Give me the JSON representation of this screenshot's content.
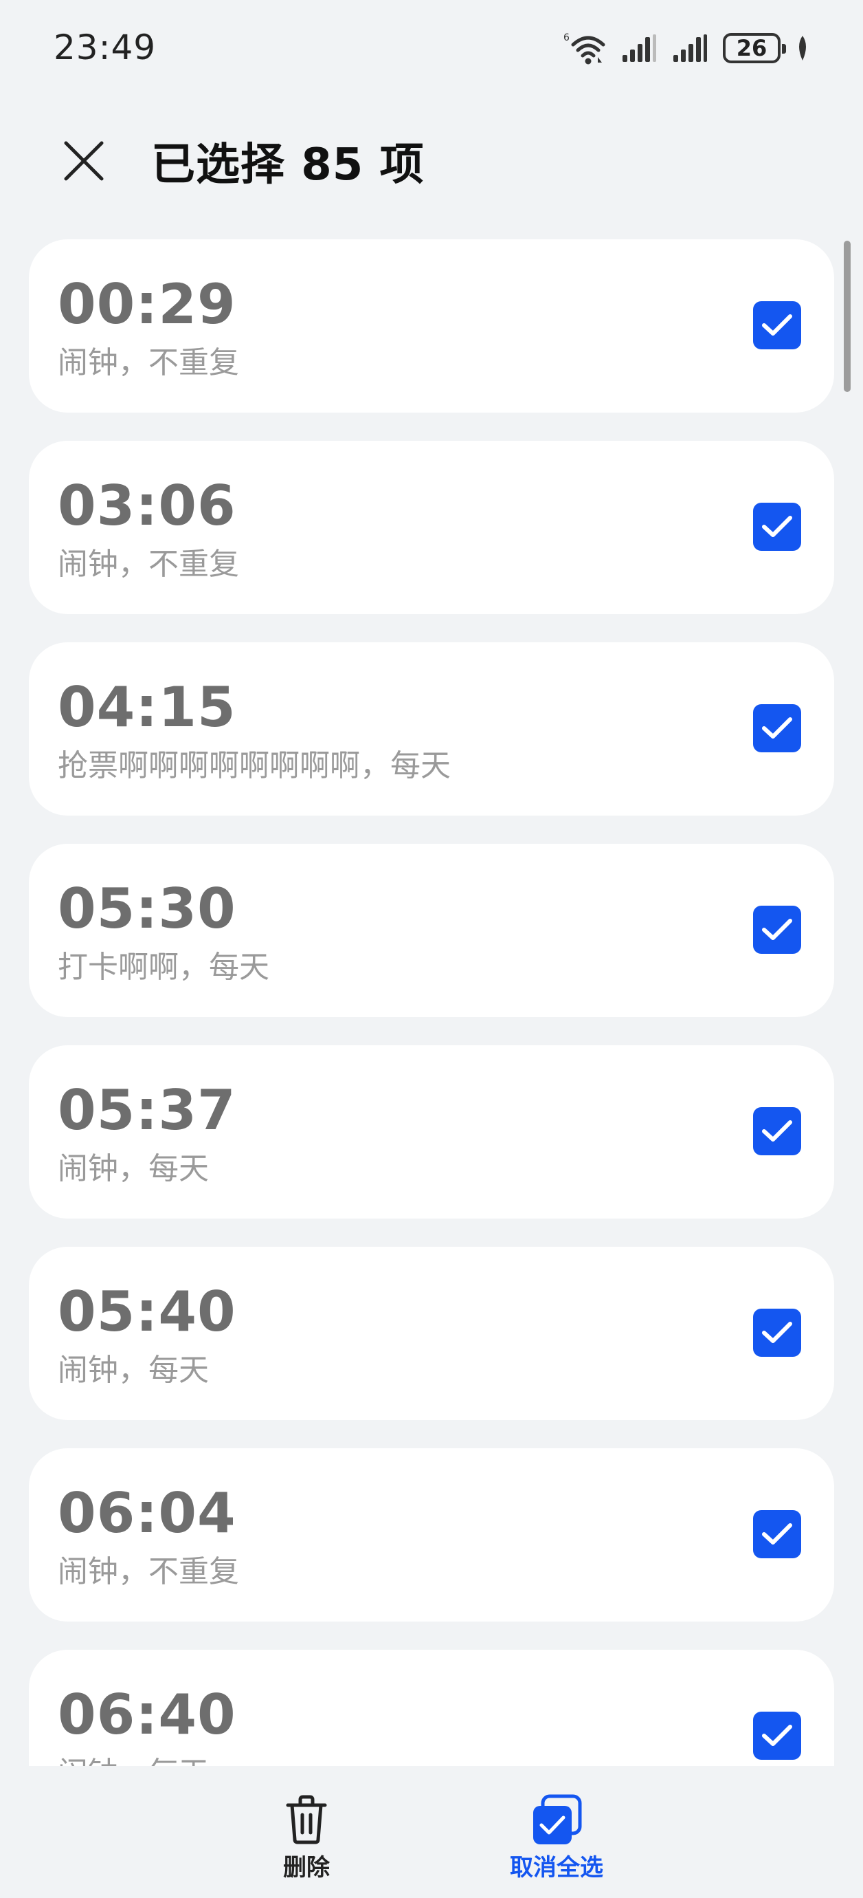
{
  "status_bar": {
    "time": "23:49",
    "battery": "26",
    "icons": [
      "wifi-6-icon",
      "signal-icon",
      "signal-icon",
      "battery-icon",
      "leaf-icon"
    ]
  },
  "header": {
    "title": "已选择 85 项",
    "close_icon": "close-icon"
  },
  "alarms": [
    {
      "time": "00:29",
      "desc": "闹钟，不重复",
      "checked": true
    },
    {
      "time": "03:06",
      "desc": "闹钟，不重复",
      "checked": true
    },
    {
      "time": "04:15",
      "desc": "抢票啊啊啊啊啊啊啊啊，每天",
      "checked": true
    },
    {
      "time": "05:30",
      "desc": "打卡啊啊，每天",
      "checked": true
    },
    {
      "time": "05:37",
      "desc": "闹钟，每天",
      "checked": true
    },
    {
      "time": "05:40",
      "desc": "闹钟，每天",
      "checked": true
    },
    {
      "time": "06:04",
      "desc": "闹钟，不重复",
      "checked": true
    },
    {
      "time": "06:40",
      "desc": "闹钟，每天",
      "checked": true
    }
  ],
  "bottom_bar": {
    "delete_label": "删除",
    "deselect_all_label": "取消全选"
  },
  "colors": {
    "accent": "#1456f0",
    "background": "#f1f3f5",
    "card": "#ffffff"
  }
}
